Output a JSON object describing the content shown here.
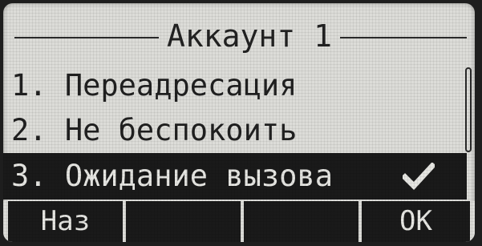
{
  "screen": {
    "title": "Аккаунт 1",
    "menu": {
      "items": [
        {
          "label": "1. Переадресация"
        },
        {
          "label": "2. Не беспокоить"
        },
        {
          "label": "3. Ожидание вызова",
          "selected": true,
          "checked": true
        }
      ],
      "checkmark_icon": "check-icon"
    },
    "softkeys": [
      {
        "label": "Наз"
      },
      {
        "label": ""
      },
      {
        "label": ""
      },
      {
        "label": "ОК"
      }
    ]
  },
  "colors": {
    "lcd_background": "#dcdcd8",
    "lcd_ink": "#1a1a1a",
    "highlight_text": "#e6e6e2"
  }
}
